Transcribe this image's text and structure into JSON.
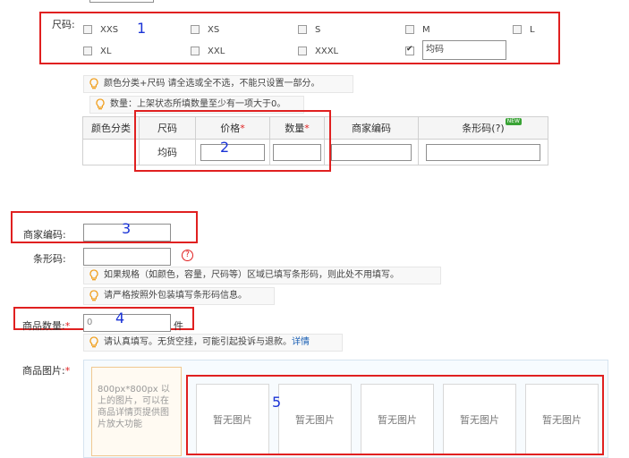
{
  "size_section": {
    "label": "尺码:",
    "options": [
      {
        "label": "XXS",
        "checked": false
      },
      {
        "label": "XS",
        "checked": false
      },
      {
        "label": "S",
        "checked": false
      },
      {
        "label": "M",
        "checked": false
      },
      {
        "label": "L",
        "checked": false
      },
      {
        "label": "XL",
        "checked": false
      },
      {
        "label": "XXL",
        "checked": false
      },
      {
        "label": "XXXL",
        "checked": false
      }
    ],
    "custom_checked": true,
    "custom_value": "均码"
  },
  "hints": {
    "color_size": "颜色分类+尺码 请全选或全不选，不能只设置一部分。",
    "quantity": "数量：上架状态所填数量至少有一项大于0。",
    "barcode": "如果规格（如颜色，容量，尺码等）区域已填写条形码，则此处不用填写。",
    "barcode_strict": "请严格按照外包装填写条形码信息。",
    "stock_prefix": "请认真填写。无货空挂，可能引起投诉与退款。",
    "stock_link": "详情"
  },
  "sku_table": {
    "headers": {
      "color": "颜色分类",
      "size": "尺码",
      "price": "价格",
      "qty": "数量",
      "merchant_code": "商家编码",
      "barcode": "条形码(?)",
      "required_mark": "*",
      "new_badge": "NEW"
    },
    "row": {
      "size": "均码"
    }
  },
  "form": {
    "merchant_code_label": "商家编码:",
    "barcode_label": "条形码:",
    "qty_label": "商品数量:",
    "qty_value": "0",
    "qty_unit": "件",
    "images_label": "商品图片:",
    "required_mark": "*",
    "help_glyph": "?"
  },
  "images": {
    "main_hint": "800px*800px 以上的图片，可以在商品详情页提供图片放大功能",
    "placeholder": "暂无图片",
    "slots": [
      "暂无图片",
      "暂无图片",
      "暂无图片",
      "暂无图片",
      "暂无图片"
    ]
  },
  "annotations": [
    "1",
    "2",
    "3",
    "4",
    "5"
  ],
  "colors": {
    "annotation_red": "#e02020",
    "annotation_blue": "#1a33d6",
    "link_blue": "#1a5fb4",
    "bulb": "#f0a020"
  }
}
